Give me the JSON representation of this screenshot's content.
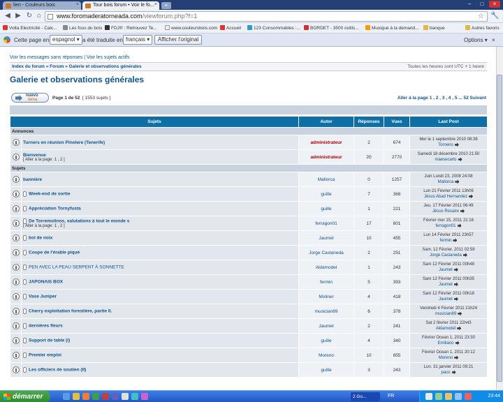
{
  "browser": {
    "tabs": [
      {
        "title": "lien - Couleurs bois"
      },
      {
        "title": "Tour bois forum • Voir le fo..."
      }
    ],
    "new_tab": "+",
    "url_domain": "www.foromaderatorneada.com",
    "url_path": "/viewforum.php?f=1",
    "bookmarks": [
      "Volta Electricité - Calc...",
      "Les fous du bois",
      "FDJ® : Retrouvez Te...",
      "www.couleursbois.com",
      "Accueil",
      "123 Consommables :...",
      "BORDET - 3500 outils...",
      "Musique à la demand...",
      "banque",
      "Autres favoris"
    ]
  },
  "translate_bar": {
    "prefix": "Cette page en",
    "source_lang": "espagnol",
    "middle": "a été traduite en",
    "target_lang": "français",
    "show_original": "Afficher l'original",
    "options": "Options"
  },
  "forum": {
    "link_unanswered": "Voir les messages sans réponses",
    "link_active": "Voir les sujets actifs",
    "breadcrumb": "Index du forum » Forum » Galerie et observations générales",
    "timezone": "Toutes les heures sont UTC + 1 heure",
    "title": "Galerie et observations générales",
    "new_topic_l1": "nuevo",
    "new_topic_l2": "tema",
    "page_info": "Page 1 de 52",
    "topic_count": "[ 1553 sujets ]",
    "pager": "Aller à la page 1 , 2 , 3 , 4 , 5 ... 52  Suivant",
    "headers": {
      "subjects": "Sujets",
      "author": "Autor",
      "replies": "Réponses",
      "views": "Vues",
      "last": "Last Post"
    },
    "section_announcements": "Annonces",
    "section_topics": "Sujets",
    "announcements": [
      {
        "title": "Turners en réunion Pinolere (Tenerife)",
        "author": "administrateur",
        "replies": "2",
        "views": "674",
        "last_date": "Mer le 1 septembre 2010 08:38",
        "last_user": "Torneiru"
      },
      {
        "title": "Bienvenue",
        "goto": "[ Aller à la page: 1 , 2 ]",
        "author": "administrateur",
        "replies": "20",
        "views": "2770",
        "last_date": "Samedi 18 décembre 2010 21:50",
        "last_user": "maesecarlo"
      }
    ],
    "topics": [
      {
        "title": "bannière",
        "author": "Mallorca",
        "replies": "0",
        "views": "1257",
        "last_date": "Juin Lundi 23, 2008 24:08",
        "last_user": "Mallorca"
      },
      {
        "title": "Week-end de sortie",
        "author": "guille",
        "replies": "7",
        "views": "368",
        "last_date": "Lun 21 Février 2011 13h06",
        "last_user": "Jésus Abad Hernandez"
      },
      {
        "title": "Appréciation Tornyfusta",
        "author": "guille",
        "replies": "1",
        "views": "221",
        "last_date": "Jeu. 17 Février 2011 06:49",
        "last_user": "Jésus Rosaire"
      },
      {
        "title": "De Torremolinos, salutations à tout le monde s",
        "goto": "[ Aller à la page: 1 , 2 ]",
        "author": "ferragon01",
        "replies": "17",
        "views": "601",
        "last_date": "Février mer 15, 2011 21:16",
        "last_user": "ferragon01"
      },
      {
        "title": "bol de noix",
        "author": "Jaumet",
        "replies": "10",
        "views": "455",
        "last_date": "Lun 14 Février 2011 23h57",
        "last_user": "fermin"
      },
      {
        "title": "Coupe de l'érable piqué",
        "author": "Jorge Castaneda",
        "replies": "2",
        "views": "251",
        "last_date": "Sam. 12 Février, 2011 02:59",
        "last_user": "Jorge Castaneda"
      },
      {
        "title": "PEN AVEC LA PEAU SERPENT À SONNETTE",
        "plain": true,
        "author": "Aldamodel",
        "replies": "1",
        "views": "243",
        "last_date": "Sam 12 Février 2011 00h48",
        "last_user": "Jaumet"
      },
      {
        "title": "JAPONAIS BOX",
        "author": "fermin",
        "replies": "5",
        "views": "393",
        "last_date": "Sam 12 Février 2011 00h35",
        "last_user": "Jaumet"
      },
      {
        "title": "Vase Juniper",
        "author": "Moliner",
        "replies": "4",
        "views": "418",
        "last_date": "Sam 12 Février 2011 00h18",
        "last_user": "Jaumet"
      },
      {
        "title": "Cherry exploitation forestière, partie II.",
        "author": "musician89",
        "replies": "6",
        "views": "378",
        "last_date": "Vendredi 4 Février 2011 21h24",
        "last_user": "musician89"
      },
      {
        "title": "dernières fleurs",
        "author": "Jaumet",
        "replies": "2",
        "views": "241",
        "last_date": "Sat 2 février 2011 22h43",
        "last_user": "Aldamodel"
      },
      {
        "title": "Support de table (i)",
        "author": "guille",
        "replies": "4",
        "views": "340",
        "last_date": "Février Ocean 1, 2011 23:30",
        "last_user": "Emiliano"
      },
      {
        "title": "Premier emploi",
        "author": "Moreno",
        "replies": "10",
        "views": "855",
        "last_date": "Février Ocean 1, 2011 20:12",
        "last_user": "Moreno"
      },
      {
        "title": "Les officiers de soutien (II)",
        "author": "guille",
        "replies": "3",
        "views": "243",
        "last_date": "Lun. 31 janvier 2011 09:21",
        "last_user": "paco"
      }
    ]
  },
  "taskbar": {
    "start": "démarrer",
    "task": "2 Go...",
    "lang": "FR",
    "clock": "23:44"
  }
}
